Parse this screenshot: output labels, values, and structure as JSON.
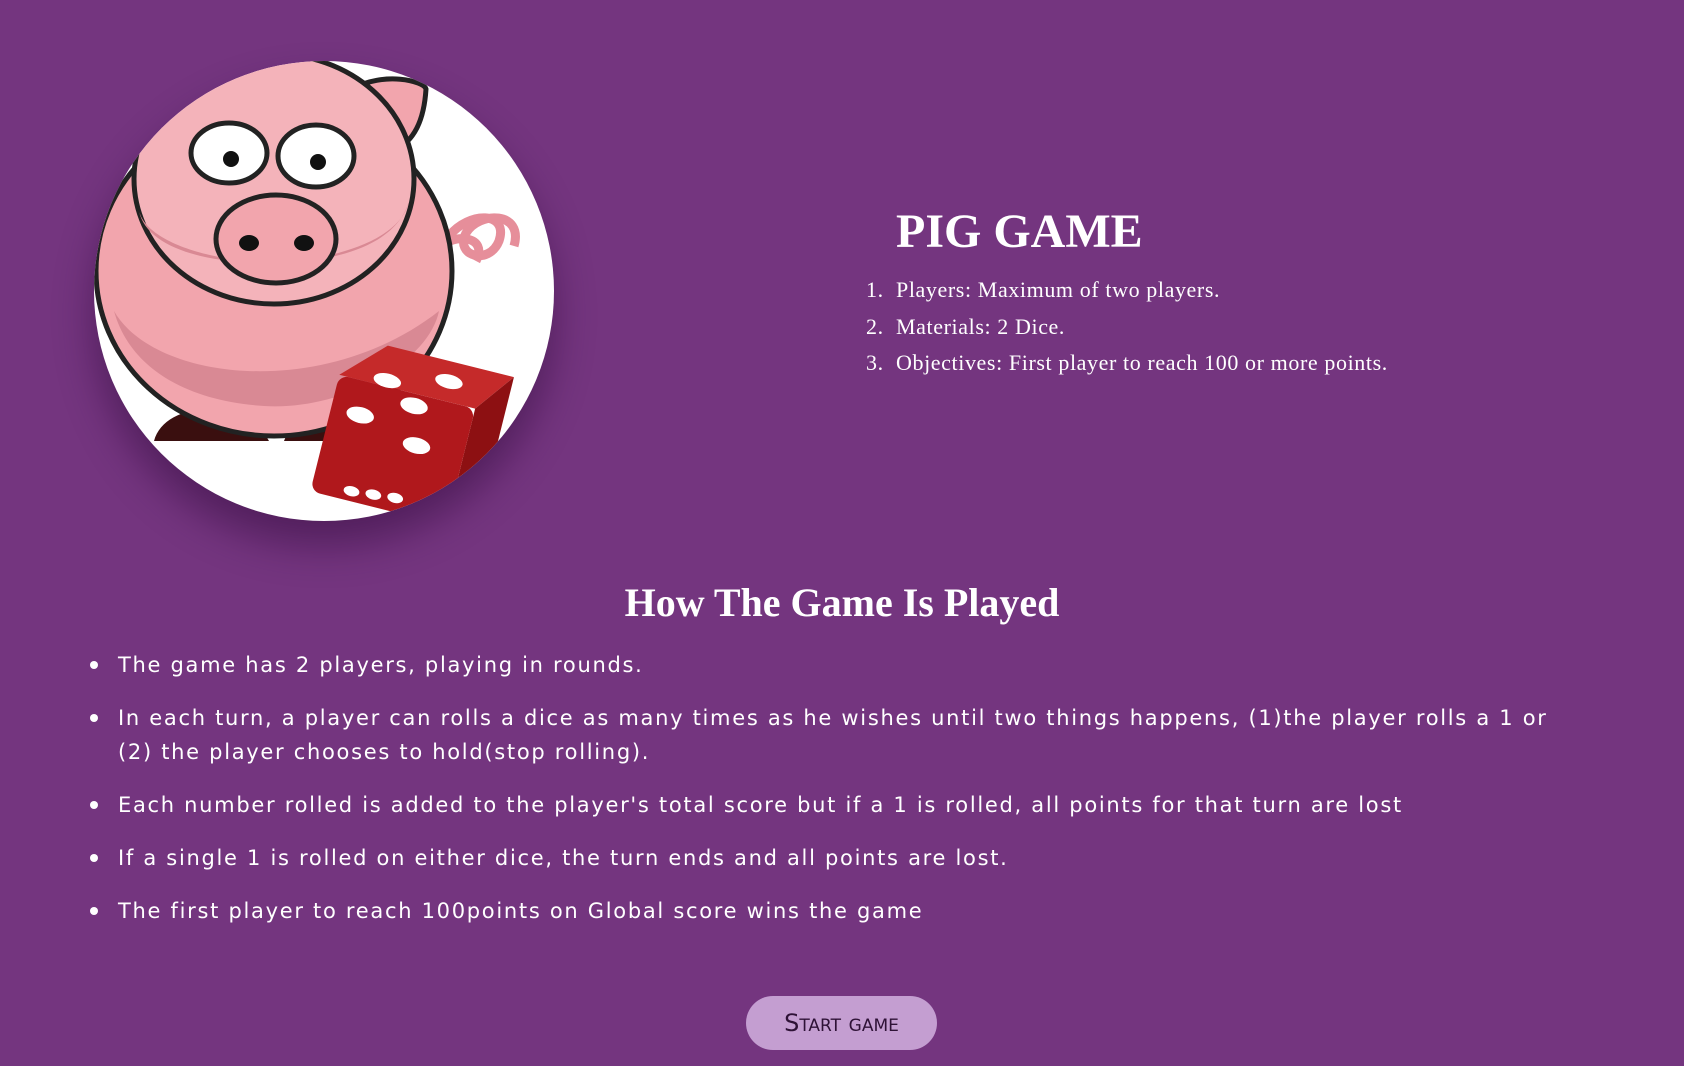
{
  "logo": {
    "description_icon": "pig-with-dice-icon"
  },
  "intro": {
    "title": "PIG GAME",
    "rules": [
      {
        "num": "1.",
        "text": "Players: Maximum of two players."
      },
      {
        "num": "2.",
        "text": "Materials: 2 Dice."
      },
      {
        "num": "3.",
        "text": "Objectives: First player to reach 100 or more points."
      }
    ]
  },
  "how": {
    "title": "How The Game Is Played",
    "items": [
      "The game has 2 players, playing in rounds.",
      "In each turn, a player can rolls a dice as many times as he wishes until two things happens, (1)the player rolls a 1 or (2) the player chooses to hold(stop rolling).",
      "Each number rolled is added to the player's total score but if a 1 is rolled, all points for that turn are lost",
      "If a single 1 is rolled on either dice, the turn ends and all points are lost.",
      "The first player to reach 100points on Global score wins the game"
    ]
  },
  "actions": {
    "start_label": "Start game"
  },
  "colors": {
    "background": "#74357f",
    "button": "#c49ed1",
    "button_text": "#2e1236",
    "pig_pink": "#f2a5ad",
    "dice_red": "#b0181c"
  }
}
